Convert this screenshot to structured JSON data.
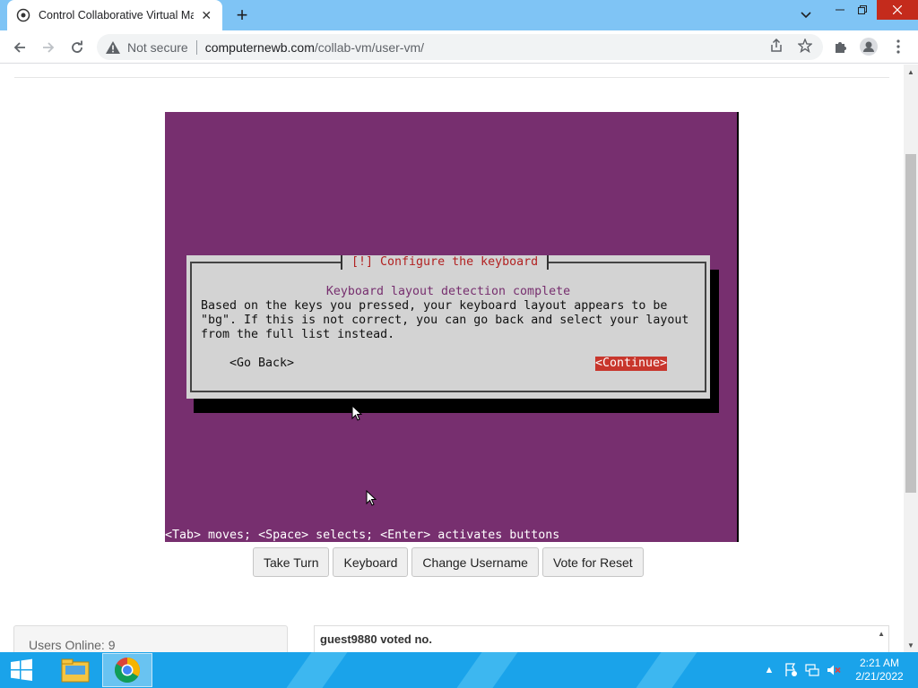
{
  "browser": {
    "tab_title": "Control Collaborative Virtual Ma",
    "security_label": "Not secure",
    "url_host": "computernewb.com",
    "url_path": "/collab-vm/user-vm/"
  },
  "vm": {
    "dialog": {
      "title": "[!] Configure the keyboard",
      "heading": "Keyboard layout detection complete",
      "body": "Based on the keys you pressed, your keyboard layout appears to be\n\"bg\". If this is not correct, you can go back and select your layout\nfrom the full list instead.",
      "go_back_label": "<Go Back>",
      "continue_label": "<Continue>"
    },
    "hint": "<Tab> moves; <Space> selects; <Enter> activates buttons"
  },
  "controls": {
    "take_turn": "Take Turn",
    "keyboard": "Keyboard",
    "change_username": "Change Username",
    "vote_reset": "Vote for Reset"
  },
  "users": {
    "online_text": "Users Online: 9"
  },
  "chat": {
    "messages": [
      "guest9880 voted no."
    ]
  },
  "taskbar": {
    "time": "2:21 AM",
    "date": "2/21/2022"
  },
  "colors": {
    "vm_background": "#772f6f",
    "dialog_background": "#d3d3d3",
    "dialog_title": "#b22222",
    "continue_highlight": "#c8362c",
    "taskbar": "#1aa3ea",
    "tabbar": "#7fc4f5"
  },
  "icons": {
    "tab_favicon": "collabvm-icon",
    "security": "warning-icon",
    "share": "share-icon",
    "bookmark": "star-icon",
    "extensions": "puzzle-icon",
    "profile": "profile-icon",
    "menu": "kebab-menu-icon"
  }
}
